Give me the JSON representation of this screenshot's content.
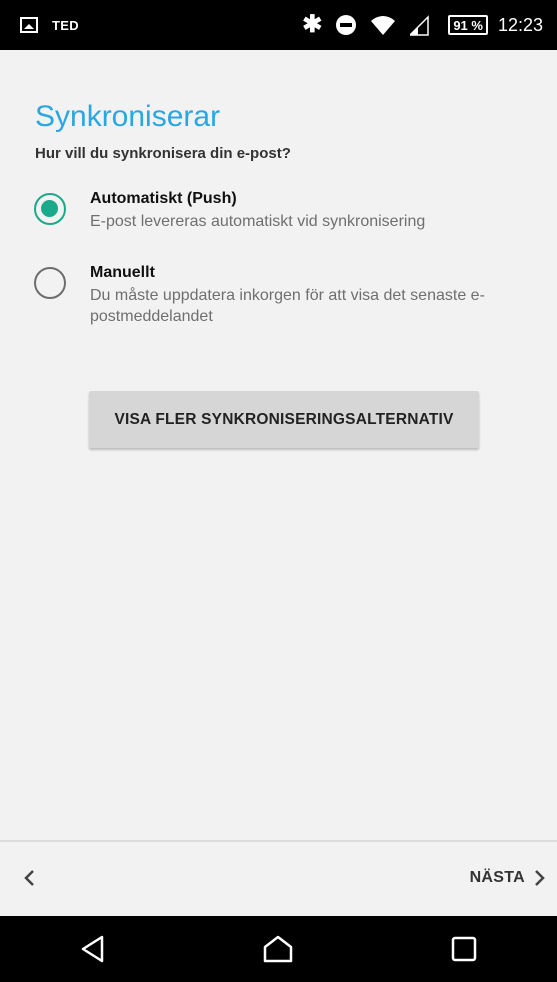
{
  "status_bar": {
    "carrier": "TED",
    "battery": "91 %",
    "time": "12:23",
    "icons": [
      "image-icon",
      "bluetooth-icon",
      "do-not-disturb-icon",
      "wifi-icon",
      "signal-icon",
      "battery-icon"
    ]
  },
  "page": {
    "title": "Synkroniserar",
    "subtitle": "Hur vill du synkronisera din e-post?"
  },
  "options": [
    {
      "label": "Automatiskt (Push)",
      "description": "E-post levereras automatiskt vid synkronisering",
      "selected": true
    },
    {
      "label": "Manuellt",
      "description": "Du måste uppdatera inkorgen för att visa det senaste e-postmeddelandet",
      "selected": false
    }
  ],
  "more_button": {
    "label": "VISA FLER SYNKRONISERINGSALTERNATIV"
  },
  "wizard": {
    "back_icon": "chevron-left-icon",
    "next_label": "NÄSTA",
    "next_icon": "chevron-right-icon"
  },
  "nav": {
    "buttons": [
      "back-triangle-icon",
      "home-icon",
      "recents-icon"
    ]
  },
  "colors": {
    "accent": "#29a7e1",
    "radio_selected": "#1aa98a",
    "background": "#f2f2f2"
  }
}
